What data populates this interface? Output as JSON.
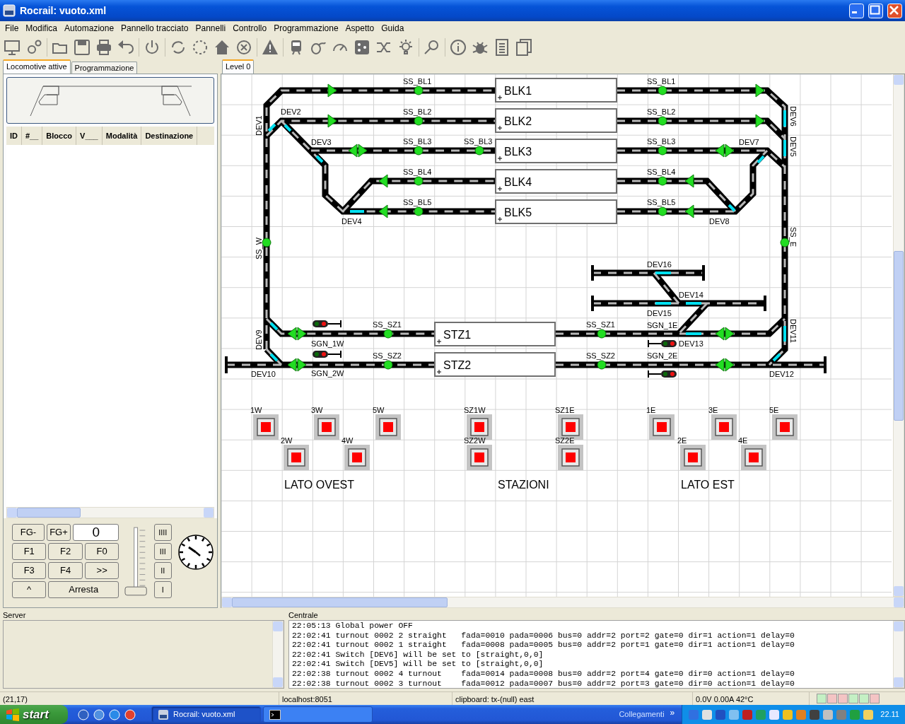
{
  "window": {
    "title": "Rocrail: vuoto.xml"
  },
  "menu": [
    "File",
    "Modifica",
    "Automazione",
    "Pannello tracciato",
    "Pannelli",
    "Controllo",
    "Programmazione",
    "Aspetto",
    "Guida"
  ],
  "left_tabs": [
    {
      "label": "Locomotive attive",
      "selected": true
    },
    {
      "label": "Programmazione",
      "selected": false
    }
  ],
  "loco_table": {
    "columns": [
      "ID",
      "#__",
      "Blocco",
      "V___",
      "Modalità",
      "Destinazione"
    ]
  },
  "throttle": {
    "group_buttons": [
      "FG-",
      "FG+"
    ],
    "speed": "0",
    "function_buttons": [
      "F1",
      "F2",
      "F0",
      "F3",
      "F4",
      ">>"
    ],
    "direction": "^",
    "stop": "Arresta",
    "steps": [
      "IIII",
      "III",
      "II",
      "I"
    ],
    "level": 0
  },
  "plan_tabs": [
    {
      "label": "Level 0",
      "selected": true
    }
  ],
  "plan": {
    "blocks": [
      "BLK1",
      "BLK2",
      "BLK3",
      "BLK4",
      "BLK5",
      "STZ1",
      "STZ2"
    ],
    "switches": [
      "DEV1",
      "DEV2",
      "DEV3",
      "DEV4",
      "DEV5",
      "DEV6",
      "DEV7",
      "DEV8",
      "DEV9",
      "DEV10",
      "DEV11",
      "DEV12",
      "DEV13",
      "DEV14",
      "DEV15",
      "DEV16"
    ],
    "sensors": [
      "SS_BL1",
      "SS_BL1",
      "SS_BL2",
      "SS_BL2",
      "SS_BL3",
      "SS_BL3",
      "SS_BL3",
      "SS_BL4",
      "SS_BL4",
      "SS_BL5",
      "SS_BL5",
      "SS_W",
      "SS_E",
      "SS_SZ1",
      "SS_SZ1",
      "SS_SZ2",
      "SS_SZ2"
    ],
    "signals": [
      "SGN_1W",
      "SGN_2W",
      "SGN_1E",
      "SGN_2E"
    ],
    "route_buttons": [
      "1W",
      "3W",
      "5W",
      "SZ1W",
      "SZ1E",
      "1E",
      "3E",
      "5E",
      "2W",
      "4W",
      "SZ2W",
      "SZ2E",
      "2E",
      "4E"
    ],
    "areas": [
      "LATO OVEST",
      "STAZIONI",
      "LATO EST"
    ]
  },
  "server": {
    "title": "Server"
  },
  "centrale": {
    "title": "Centrale",
    "log": [
      "22:05:13 Global power OFF",
      "22:02:41 turnout 0002 2 straight   fada=0010 pada=0006 bus=0 addr=2 port=2 gate=0 dir=1 action=1 delay=0",
      "22:02:41 turnout 0002 1 straight   fada=0008 pada=0005 bus=0 addr=2 port=1 gate=0 dir=1 action=1 delay=0",
      "22:02:41 Switch [DEV6] will be set to [straight,0,0]",
      "22:02:41 Switch [DEV5] will be set to [straight,0,0]",
      "22:02:38 turnout 0002 4 turnout    fada=0014 pada=0008 bus=0 addr=2 port=4 gate=0 dir=0 action=1 delay=0",
      "22:02:38 turnout 0002 3 turnout    fada=0012 pada=0007 bus=0 addr=2 port=3 gate=0 dir=0 action=1 delay=0"
    ]
  },
  "status_bar": [
    "(21,17)",
    "localhost:8051",
    "clipboard: tx-(null) east",
    "0.0V 0.00A 42°C"
  ],
  "status_lights": [
    {
      "color": "#c4f0c4"
    },
    {
      "color": "#f4c4c4"
    },
    {
      "color": "#f4c4c4"
    },
    {
      "color": "#c4f0c4"
    },
    {
      "color": "#c4f0c4"
    },
    {
      "color": "#f4c4c4"
    }
  ],
  "taskbar": {
    "start": "start",
    "windows": [
      {
        "label": "Rocrail: vuoto.xml",
        "selected": true
      },
      {
        "selected": false
      }
    ],
    "links": "Collegamenti",
    "chevron": "»",
    "clock": "22.11"
  }
}
